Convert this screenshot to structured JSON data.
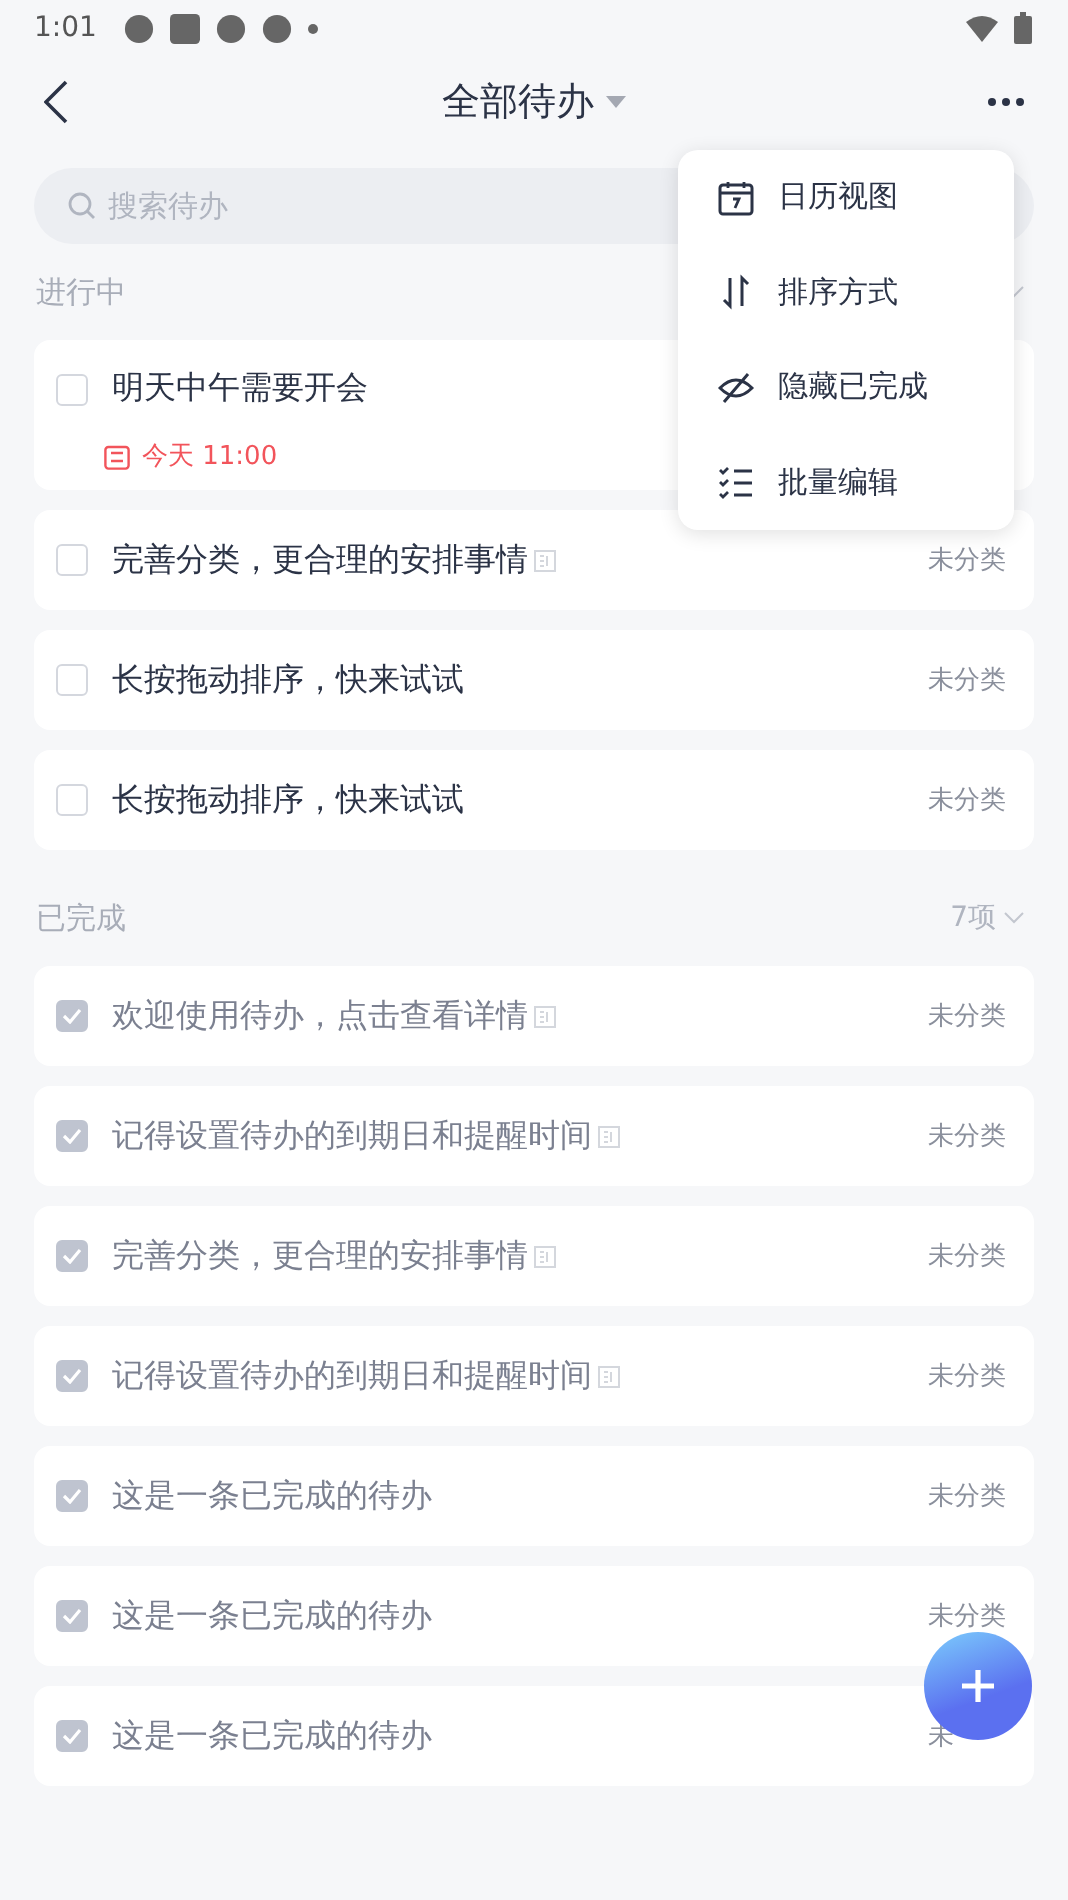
{
  "status_bar": {
    "time": "1:01"
  },
  "header": {
    "title": "全部待办"
  },
  "search": {
    "placeholder": "搜索待办"
  },
  "sections": [
    {
      "title": "进行中",
      "todos": [
        {
          "title": "明天中午需要开会",
          "checked": false,
          "has_note": false,
          "due": "今天 11:00"
        },
        {
          "title": "完善分类，更合理的安排事情",
          "checked": false,
          "has_note": true,
          "category": "未分类"
        },
        {
          "title": "长按拖动排序，快来试试",
          "checked": false,
          "has_note": false,
          "category": "未分类"
        },
        {
          "title": "长按拖动排序，快来试试",
          "checked": false,
          "has_note": false,
          "category": "未分类"
        }
      ]
    },
    {
      "title": "已完成",
      "count": "7项",
      "todos": [
        {
          "title": "欢迎使用待办，点击查看详情",
          "checked": true,
          "has_note": true,
          "category": "未分类"
        },
        {
          "title": "记得设置待办的到期日和提醒时间",
          "checked": true,
          "has_note": true,
          "category": "未分类"
        },
        {
          "title": "完善分类，更合理的安排事情",
          "checked": true,
          "has_note": true,
          "category": "未分类"
        },
        {
          "title": "记得设置待办的到期日和提醒时间",
          "checked": true,
          "has_note": true,
          "category": "未分类"
        },
        {
          "title": "这是一条已完成的待办",
          "checked": true,
          "has_note": false,
          "category": "未分类"
        },
        {
          "title": "这是一条已完成的待办",
          "checked": true,
          "has_note": false,
          "category": "未分类"
        },
        {
          "title": "这是一条已完成的待办",
          "checked": true,
          "has_note": false,
          "category": "未"
        }
      ]
    }
  ],
  "menu": [
    {
      "label": "日历视图",
      "kind": "calendar"
    },
    {
      "label": "排序方式",
      "kind": "sort"
    },
    {
      "label": "隐藏已完成",
      "kind": "hide"
    },
    {
      "label": "批量编辑",
      "kind": "batch"
    }
  ]
}
